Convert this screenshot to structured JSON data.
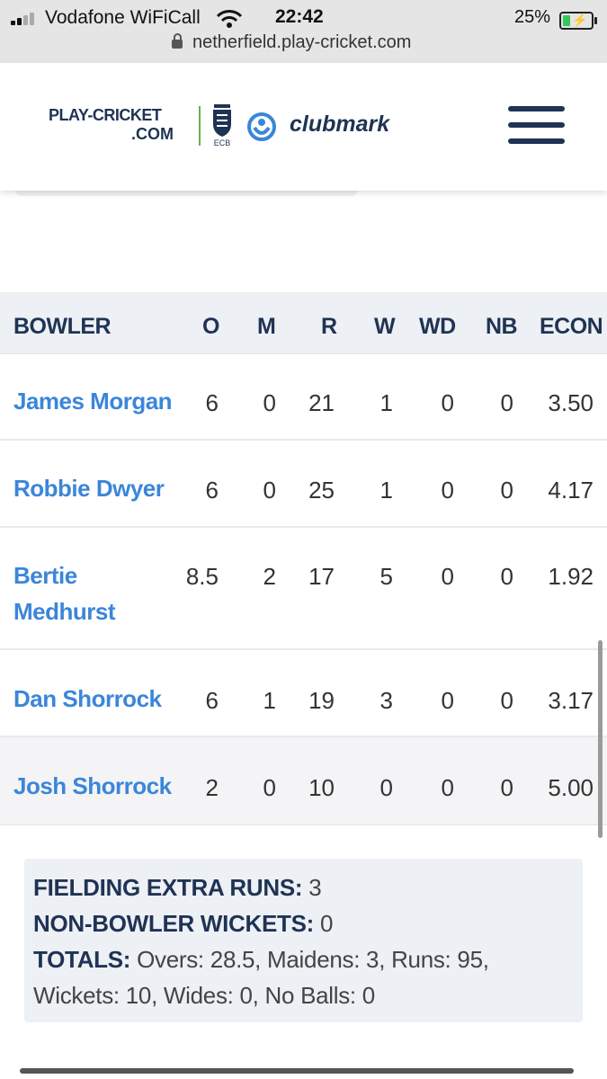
{
  "status_bar": {
    "carrier": "Vodafone WiFiCall",
    "time": "22:42",
    "battery_percent": "25%",
    "battery_level": 0.25,
    "url": "netherfield.play-cricket.com"
  },
  "header": {
    "logo_line1": "PLAY-CRICKET",
    "logo_line2": ".COM",
    "ecb_label": "ECB",
    "clubmark": "clubmark"
  },
  "table": {
    "columns": [
      "BOWLER",
      "O",
      "M",
      "R",
      "W",
      "WD",
      "NB",
      "ECON"
    ],
    "rows": [
      {
        "name": "James Morgan",
        "name_l1": "James Morgan",
        "name_l2": "",
        "o": "6",
        "m": "0",
        "r": "21",
        "w": "1",
        "wd": "0",
        "nb": "0",
        "econ": "3.50"
      },
      {
        "name": "Robbie Dwyer",
        "name_l1": "Robbie Dwyer",
        "name_l2": "",
        "o": "6",
        "m": "0",
        "r": "25",
        "w": "1",
        "wd": "0",
        "nb": "0",
        "econ": "4.17"
      },
      {
        "name": "Bertie Medhurst",
        "name_l1": "Bertie",
        "name_l2": "Medhurst",
        "o": "8.5",
        "m": "2",
        "r": "17",
        "w": "5",
        "wd": "0",
        "nb": "0",
        "econ": "1.92"
      },
      {
        "name": "Dan Shorrock",
        "name_l1": "Dan Shorrock",
        "name_l2": "",
        "o": "6",
        "m": "1",
        "r": "19",
        "w": "3",
        "wd": "0",
        "nb": "0",
        "econ": "3.17"
      },
      {
        "name": "Josh Shorrock",
        "name_l1": "Josh Shorrock",
        "name_l2": "",
        "o": "2",
        "m": "0",
        "r": "10",
        "w": "0",
        "wd": "0",
        "nb": "0",
        "econ": "5.00"
      }
    ]
  },
  "summary": {
    "fielding_label": "FIELDING EXTRA RUNS:",
    "fielding_value": "3",
    "nonbowler_label": "NON-BOWLER WICKETS:",
    "nonbowler_value": "0",
    "totals_label": "TOTALS:",
    "totals_value": "Overs: 28.5, Maidens: 3, Runs: 95, Wickets: 10, Wides: 0, No Balls: 0"
  },
  "colors": {
    "brand_navy": "#1f3354",
    "link_blue": "#3b86d9",
    "header_bg": "#edf0f4",
    "accent_green": "#6ab04c"
  }
}
